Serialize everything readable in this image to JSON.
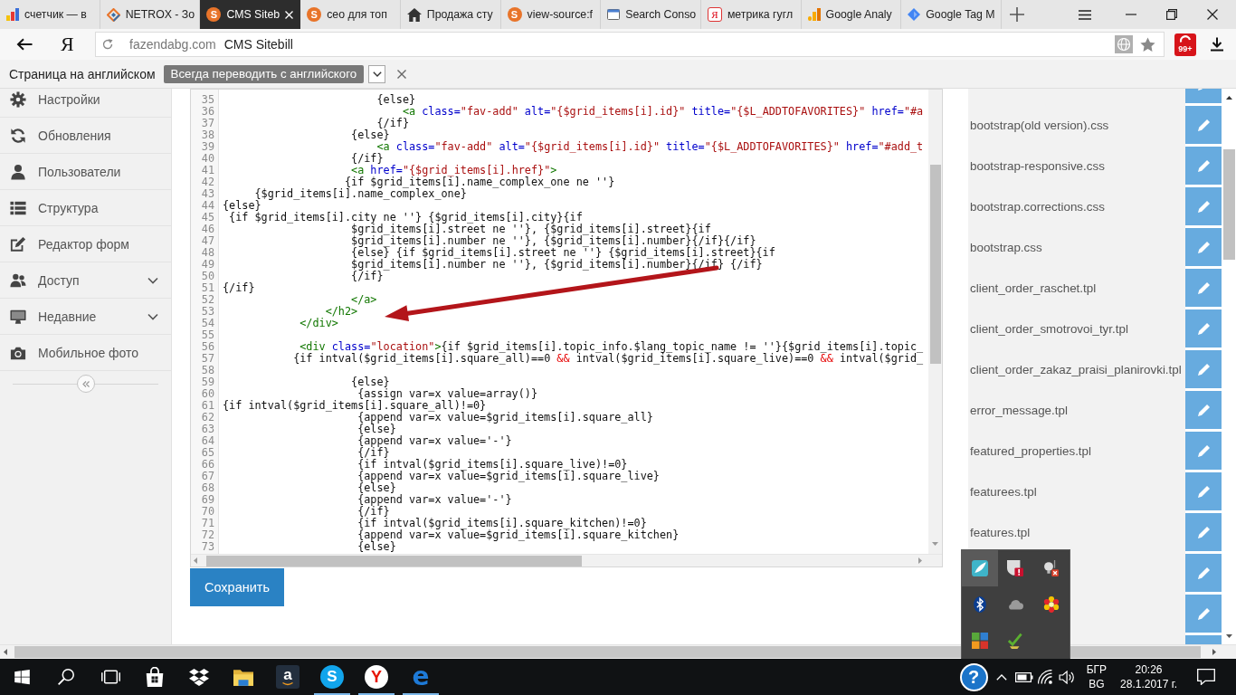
{
  "tabs": [
    {
      "title": "счетчик — в",
      "kind": "bars",
      "selected": false
    },
    {
      "title": "NETROX - Зо",
      "kind": "diamond-outline",
      "selected": false
    },
    {
      "title": "CMS Siteb",
      "kind": "letter",
      "glyph": "S",
      "selected": true
    },
    {
      "title": "сео для топ",
      "kind": "letter",
      "glyph": "S",
      "selected": false
    },
    {
      "title": "Продажа сту",
      "kind": "house",
      "selected": false
    },
    {
      "title": "view-source:f",
      "kind": "letter",
      "glyph": "S",
      "selected": false
    },
    {
      "title": "Search Conso",
      "kind": "window",
      "selected": false
    },
    {
      "title": "метрика гугл",
      "kind": "yandex",
      "glyph": "Я",
      "selected": false
    },
    {
      "title": "Google Analy",
      "kind": "columns",
      "selected": false
    },
    {
      "title": "Google Tag M",
      "kind": "diamond",
      "selected": false
    }
  ],
  "toolbar": {
    "logo": "Я",
    "domain": "fazendabg.com",
    "page_title": "CMS Sitebill",
    "badge": "99+"
  },
  "translate_bar": {
    "message": "Страница на английском",
    "button": "Всегда переводить с английского"
  },
  "sidebar": {
    "items": [
      {
        "label": "Настройки",
        "kind": "gear",
        "expandable": false
      },
      {
        "label": "Обновления",
        "kind": "refresh",
        "expandable": false
      },
      {
        "label": "Пользователи",
        "kind": "user",
        "expandable": false
      },
      {
        "label": "Структура",
        "kind": "list",
        "expandable": false
      },
      {
        "label": "Редактор форм",
        "kind": "edit",
        "expandable": false
      },
      {
        "label": "Доступ",
        "kind": "users",
        "expandable": true
      },
      {
        "label": "Недавние",
        "kind": "monitor",
        "expandable": true
      },
      {
        "label": "Мобильное фото",
        "kind": "camera",
        "expandable": false
      }
    ]
  },
  "editor": {
    "lines": [
      {
        "number": "35",
        "segments": [
          {
            "text": "                        {else}",
            "kind": "text"
          }
        ]
      },
      {
        "number": "36",
        "segments": [
          {
            "text": "                            <a",
            "kind": "tag"
          },
          {
            "text": " class=",
            "kind": "attr"
          },
          {
            "text": "\"fav-add\"",
            "kind": "string"
          },
          {
            "text": " alt=",
            "kind": "attr"
          },
          {
            "text": "\"{$grid_items[i].id}\"",
            "kind": "string"
          },
          {
            "text": " title=",
            "kind": "attr"
          },
          {
            "text": "\"{$L_ADDTOFAVORITES}\"",
            "kind": "string"
          },
          {
            "text": " href=",
            "kind": "attr"
          },
          {
            "text": "\"#a",
            "kind": "string"
          }
        ]
      },
      {
        "number": "37",
        "segments": [
          {
            "text": "                        {/if}",
            "kind": "text"
          }
        ]
      },
      {
        "number": "38",
        "segments": [
          {
            "text": "                    {else}",
            "kind": "text"
          }
        ]
      },
      {
        "number": "39",
        "segments": [
          {
            "text": "                        <a",
            "kind": "tag"
          },
          {
            "text": " class=",
            "kind": "attr"
          },
          {
            "text": "\"fav-add\"",
            "kind": "string"
          },
          {
            "text": " alt=",
            "kind": "attr"
          },
          {
            "text": "\"{$grid_items[i].id}\"",
            "kind": "string"
          },
          {
            "text": " title=",
            "kind": "attr"
          },
          {
            "text": "\"{$L_ADDTOFAVORITES}\"",
            "kind": "string"
          },
          {
            "text": " href=",
            "kind": "attr"
          },
          {
            "text": "\"#add_t",
            "kind": "string"
          }
        ]
      },
      {
        "number": "40",
        "segments": [
          {
            "text": "                    {/if}",
            "kind": "text"
          }
        ]
      },
      {
        "number": "41",
        "segments": [
          {
            "text": "                    <a",
            "kind": "tag"
          },
          {
            "text": " href=",
            "kind": "attr"
          },
          {
            "text": "\"{$grid_items[i].href}\"",
            "kind": "string"
          },
          {
            "text": ">",
            "kind": "tag"
          }
        ]
      },
      {
        "number": "42",
        "segments": [
          {
            "text": "                   {if $grid_items[i].name_complex_one ne ''}",
            "kind": "text"
          }
        ]
      },
      {
        "number": "43",
        "segments": [
          {
            "text": "     {$grid_items[i].name_complex_one}",
            "kind": "text"
          }
        ]
      },
      {
        "number": "44",
        "segments": [
          {
            "text": "{else}",
            "kind": "text"
          }
        ]
      },
      {
        "number": "45",
        "segments": [
          {
            "text": " {if $grid_items[i].city ne ''} {$grid_items[i].city}{if",
            "kind": "text"
          }
        ]
      },
      {
        "number": "46",
        "segments": [
          {
            "text": "                    $grid_items[i].street ne ''}, {$grid_items[i].street}{if",
            "kind": "text"
          }
        ]
      },
      {
        "number": "47",
        "segments": [
          {
            "text": "                    $grid_items[i].number ne ''}, {$grid_items[i].number}{/if}{/if}",
            "kind": "text"
          }
        ]
      },
      {
        "number": "48",
        "segments": [
          {
            "text": "                    {else} {if $grid_items[i].street ne ''} {$grid_items[i].street}{if",
            "kind": "text"
          }
        ]
      },
      {
        "number": "49",
        "segments": [
          {
            "text": "                    $grid_items[i].number ne ''}, {$grid_items[i].number}{/if} {/if}",
            "kind": "text"
          }
        ]
      },
      {
        "number": "50",
        "segments": [
          {
            "text": "                    {/if}",
            "kind": "text"
          }
        ]
      },
      {
        "number": "51",
        "segments": [
          {
            "text": "{/if}",
            "kind": "text"
          }
        ]
      },
      {
        "number": "52",
        "segments": [
          {
            "text": "                    </a>",
            "kind": "tag"
          }
        ]
      },
      {
        "number": "53",
        "segments": [
          {
            "text": "                </h2>",
            "kind": "tag"
          }
        ]
      },
      {
        "number": "54",
        "segments": [
          {
            "text": "            </div>",
            "kind": "tag"
          }
        ]
      },
      {
        "number": "55"
      },
      {
        "number": "56",
        "segments": [
          {
            "text": "            <div",
            "kind": "tag"
          },
          {
            "text": " class=",
            "kind": "attr"
          },
          {
            "text": "\"location\"",
            "kind": "string"
          },
          {
            "text": ">",
            "kind": "tag"
          },
          {
            "text": "{if $grid_items[i].topic_info.$lang_topic_name != ''}{$grid_items[i].topic_",
            "kind": "text"
          }
        ]
      },
      {
        "number": "57",
        "segments": [
          {
            "text": "           {if intval($grid_items[i].square_all)==0 ",
            "kind": "text"
          },
          {
            "text": "&&",
            "kind": "op"
          },
          {
            "text": " intval($grid_items[i].square_live)==0 ",
            "kind": "text"
          },
          {
            "text": "&&",
            "kind": "op"
          },
          {
            "text": " intval($grid_",
            "kind": "text"
          }
        ]
      },
      {
        "number": "58"
      },
      {
        "number": "59",
        "segments": [
          {
            "text": "                    {else}",
            "kind": "text"
          }
        ]
      },
      {
        "number": "60",
        "segments": [
          {
            "text": "                     {assign var=x value=array()}",
            "kind": "text"
          }
        ]
      },
      {
        "number": "61",
        "segments": [
          {
            "text": "{if intval($grid_items[i].square_all)!=0}",
            "kind": "text"
          }
        ]
      },
      {
        "number": "62",
        "segments": [
          {
            "text": "                     {append var=x value=$grid_items[i].square_all}",
            "kind": "text"
          }
        ]
      },
      {
        "number": "63",
        "segments": [
          {
            "text": "                     {else}",
            "kind": "text"
          }
        ]
      },
      {
        "number": "64",
        "segments": [
          {
            "text": "                     {append var=x value='-'}",
            "kind": "text"
          }
        ]
      },
      {
        "number": "65",
        "segments": [
          {
            "text": "                     {/if}",
            "kind": "text"
          }
        ]
      },
      {
        "number": "66",
        "segments": [
          {
            "text": "                     {if intval($grid_items[i].square_live)!=0}",
            "kind": "text"
          }
        ]
      },
      {
        "number": "67",
        "segments": [
          {
            "text": "                     {append var=x value=$grid_items[i].square_live}",
            "kind": "text"
          }
        ]
      },
      {
        "number": "68",
        "segments": [
          {
            "text": "                     {else}",
            "kind": "text"
          }
        ]
      },
      {
        "number": "69",
        "segments": [
          {
            "text": "                     {append var=x value='-'}",
            "kind": "text"
          }
        ]
      },
      {
        "number": "70",
        "segments": [
          {
            "text": "                     {/if}",
            "kind": "text"
          }
        ]
      },
      {
        "number": "71",
        "segments": [
          {
            "text": "                     {if intval($grid_items[i].square_kitchen)!=0}",
            "kind": "text"
          }
        ]
      },
      {
        "number": "72",
        "segments": [
          {
            "text": "                     {append var=x value=$grid_items[i].square_kitchen}",
            "kind": "text"
          }
        ]
      },
      {
        "number": "73",
        "segments": [
          {
            "text": "                     {else}",
            "kind": "text"
          }
        ]
      }
    ]
  },
  "save_button": "Сохранить",
  "files": [
    {
      "kind": "blank"
    },
    {
      "kind": "file",
      "name": "bootstrap(old version).css"
    },
    {
      "kind": "file",
      "name": "bootstrap-responsive.css"
    },
    {
      "kind": "file",
      "name": "bootstrap.corrections.css"
    },
    {
      "kind": "file",
      "name": "bootstrap.css"
    },
    {
      "kind": "file",
      "name": "client_order_raschet.tpl"
    },
    {
      "kind": "file",
      "name": "client_order_smotrovoi_tyr.tpl"
    },
    {
      "kind": "file",
      "name": "client_order_zakaz_praisi_planirovki.tpl"
    },
    {
      "kind": "file",
      "name": "error_message.tpl"
    },
    {
      "kind": "file",
      "name": "featured_properties.tpl"
    },
    {
      "kind": "file",
      "name": "featurees.tpl"
    },
    {
      "kind": "file",
      "name": "features.tpl"
    },
    {
      "kind": "blank"
    },
    {
      "kind": "blank"
    },
    {
      "kind": "blank"
    }
  ],
  "tray_popup": {
    "icons": [
      {
        "kind": "app-tile",
        "highlighted": true
      },
      {
        "kind": "shield-alert",
        "highlighted": false
      },
      {
        "kind": "bulb-error",
        "highlighted": false
      },
      {
        "kind": "bluetooth",
        "highlighted": false
      },
      {
        "kind": "cloud",
        "highlighted": false
      },
      {
        "kind": "flower",
        "highlighted": false
      },
      {
        "kind": "blocks",
        "highlighted": false
      },
      {
        "kind": "check",
        "highlighted": false
      }
    ]
  },
  "taskbar": {
    "apps": [
      {
        "kind": "start",
        "running": false
      },
      {
        "kind": "search",
        "running": false
      },
      {
        "kind": "task-view",
        "running": false
      },
      {
        "kind": "store",
        "running": false
      },
      {
        "kind": "diamonds",
        "running": false
      },
      {
        "kind": "folder",
        "running": false
      },
      {
        "kind": "letter-tile",
        "glyph": "a",
        "running": false
      },
      {
        "kind": "letter-circle",
        "glyph": "S",
        "running": true
      },
      {
        "kind": "letter-disc",
        "glyph": "Y",
        "running": true
      },
      {
        "kind": "letter-plain",
        "glyph": "e",
        "running": true
      }
    ],
    "help": "?",
    "language": {
      "name": "БГР",
      "code": "BG"
    },
    "clock": {
      "time": "20:26",
      "date": "28.1.2017 г."
    }
  }
}
